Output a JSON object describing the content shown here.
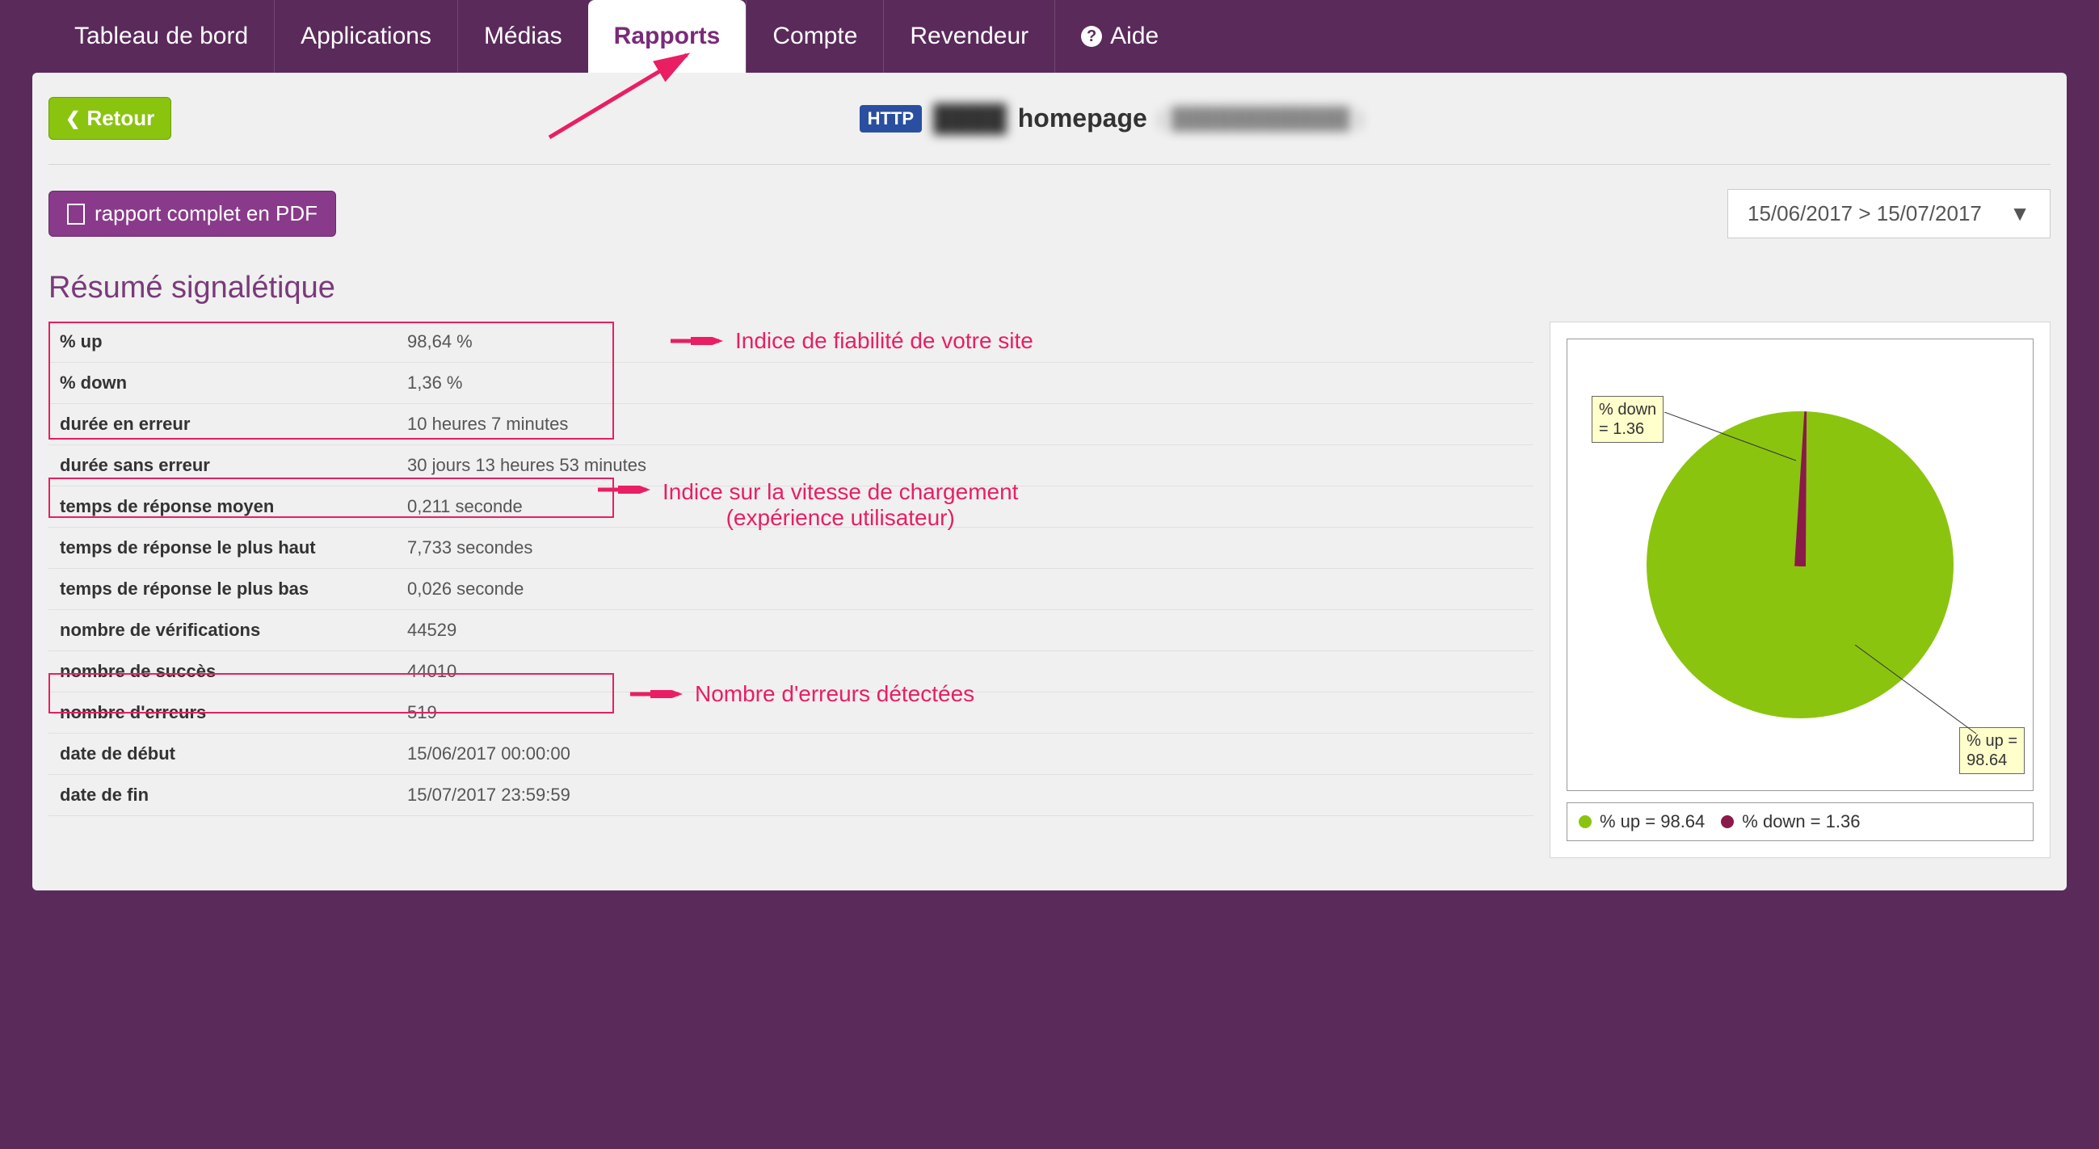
{
  "nav": {
    "dashboard": "Tableau de bord",
    "applications": "Applications",
    "medias": "Médias",
    "rapports": "Rapports",
    "compte": "Compte",
    "revendeur": "Revendeur",
    "aide": "Aide"
  },
  "header": {
    "back_label": "Retour",
    "http_badge": "HTTP",
    "title_redacted": "████",
    "title_name": "homepage",
    "title_url_redacted": "( ████████████ )"
  },
  "toolbar": {
    "pdf_label": "rapport complet en PDF",
    "date_range": "15/06/2017 > 15/07/2017"
  },
  "section": {
    "resume_title": "Résumé signalétique"
  },
  "stats": {
    "rows": [
      {
        "label": "% up",
        "value": "98,64 %"
      },
      {
        "label": "% down",
        "value": "1,36 %"
      },
      {
        "label": "durée en erreur",
        "value": "10 heures 7 minutes"
      },
      {
        "label": "durée sans erreur",
        "value": "30 jours 13 heures 53 minutes"
      },
      {
        "label": "temps de réponse moyen",
        "value": "0,211 seconde"
      },
      {
        "label": "temps de réponse le plus haut",
        "value": "7,733 secondes"
      },
      {
        "label": "temps de réponse le plus bas",
        "value": "0,026 seconde"
      },
      {
        "label": "nombre de vérifications",
        "value": "44529"
      },
      {
        "label": "nombre de succès",
        "value": "44010"
      },
      {
        "label": "nombre d'erreurs",
        "value": "519"
      },
      {
        "label": "date de début",
        "value": "15/06/2017 00:00:00"
      },
      {
        "label": "date de fin",
        "value": "15/07/2017 23:59:59"
      }
    ]
  },
  "annotations": {
    "reliability": "Indice de fiabilité de votre site",
    "speed_line1": "Indice sur la vitesse de chargement",
    "speed_line2": "(expérience utilisateur)",
    "errors": "Nombre d'erreurs détectées"
  },
  "chart_data": {
    "type": "pie",
    "title": "",
    "series": [
      {
        "name": "% up",
        "value": 98.64,
        "color": "#8bc40f"
      },
      {
        "name": "% down",
        "value": 1.36,
        "color": "#8a1a4a"
      }
    ],
    "labels": {
      "up": "% up = 98.64",
      "down": "% down = 1.36"
    },
    "legend": {
      "up": "% up = 98.64",
      "down": "% down = 1.36"
    }
  },
  "colors": {
    "brand_bg": "#5a2a5a",
    "accent_green": "#8bc40f",
    "accent_purple": "#8a3a8a",
    "annotation_pink": "#e91e63"
  }
}
